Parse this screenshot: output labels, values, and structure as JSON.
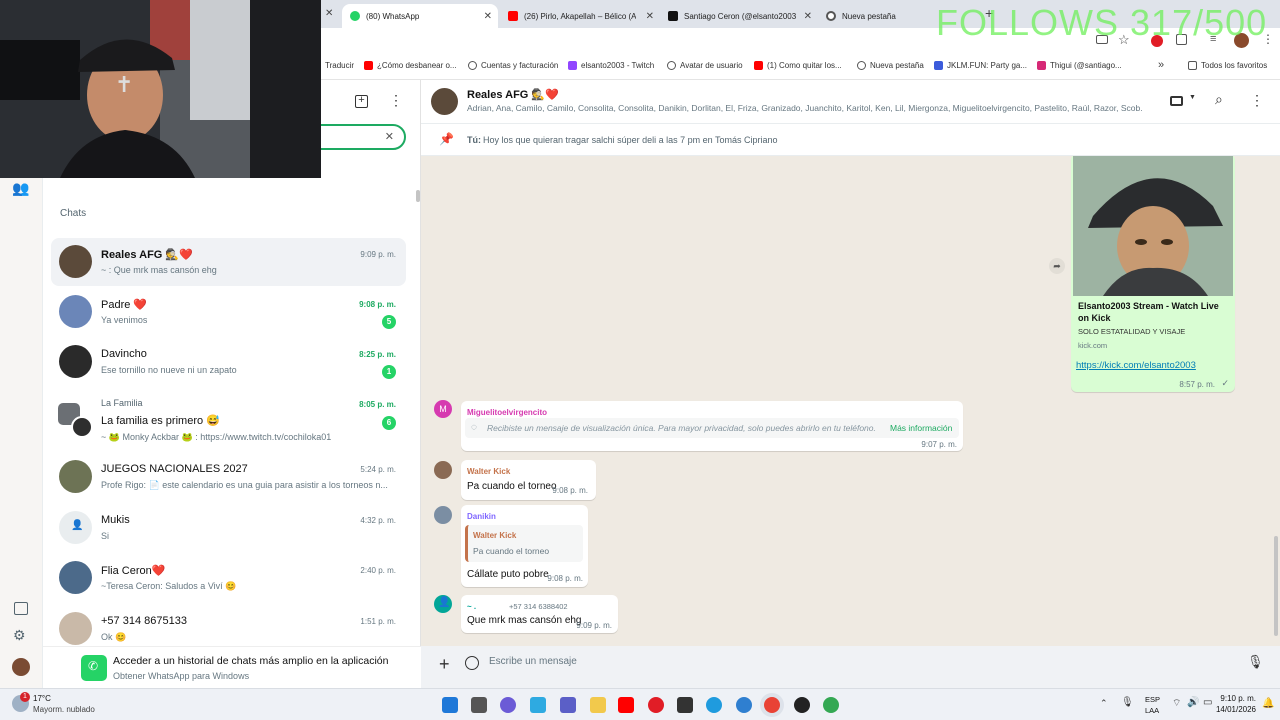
{
  "overlay": {
    "follows_text": "FOLLOWS 317/500"
  },
  "browser": {
    "tabs": [
      {
        "title": "(80) WhatsApp",
        "active": true,
        "icon": "whatsapp-icon"
      },
      {
        "title": "(26) Pirlo, Akapellah – Bélico (A",
        "active": false,
        "icon": "youtube-icon"
      },
      {
        "title": "Santiago Ceron (@elsanto2003",
        "active": false,
        "icon": "tiktok-icon"
      },
      {
        "title": "Nueva pestaña",
        "active": false,
        "icon": "chrome-icon"
      }
    ],
    "bookmarks": [
      {
        "label": "Traducir",
        "icon": ""
      },
      {
        "label": "¿Cómo desbanear o...",
        "icon": "youtube-icon"
      },
      {
        "label": "Cuentas y facturación",
        "icon": "globe-icon"
      },
      {
        "label": "elsanto2003 - Twitch",
        "icon": "twitch-icon"
      },
      {
        "label": "Avatar de usuario",
        "icon": "globe-icon"
      },
      {
        "label": "(1) Como quitar los...",
        "icon": "youtube-icon"
      },
      {
        "label": "Nueva pestaña",
        "icon": "chrome-icon"
      },
      {
        "label": "JKLM.FUN: Party ga...",
        "icon": "jklm-icon"
      },
      {
        "label": "Thigui (@santiago...",
        "icon": "instagram-icon"
      }
    ],
    "all_favorites": "Todos los favoritos"
  },
  "sidebar": {
    "section_title": "Chats",
    "chats": [
      {
        "name": "Reales AFG 🕵️❤️",
        "group": "",
        "preview": "~ : Que mrk mas cansón ehg",
        "time": "9:09 p. m.",
        "unread": "",
        "selected": true,
        "avatar_color": "#5b4a3a"
      },
      {
        "name": "Padre ❤️",
        "group": "",
        "preview": "Ya venimos",
        "time": "9:08 p. m.",
        "unread": "5",
        "selected": false,
        "avatar_color": "#6b86b8"
      },
      {
        "name": "Davincho",
        "group": "",
        "preview": "Ese tornillo no nueve ni un zapato",
        "time": "8:25 p. m.",
        "unread": "1",
        "selected": false,
        "avatar_color": "#2a2a2a"
      },
      {
        "name": "La familia es primero 😅",
        "group": "La Familia",
        "preview": "~ 🐸 Monky Ackbar 🐸 : https://www.twitch.tv/cochiloka01",
        "time": "8:05 p. m.",
        "unread": "6",
        "selected": false,
        "avatar_color": "#4a4a4a"
      },
      {
        "name": "JUEGOS NACIONALES 2027",
        "group": "",
        "preview": "Profe Rigo: 📄 este calendario es una guia para asistir a los torneos n...",
        "time": "5:24 p. m.",
        "unread": "",
        "selected": false,
        "avatar_color": "#6d7355"
      },
      {
        "name": "Mukis",
        "group": "",
        "preview": "Si",
        "time": "4:32 p. m.",
        "unread": "",
        "selected": false,
        "avatar_color": "#e9edef"
      },
      {
        "name": "Flia Ceron❤️",
        "group": "",
        "preview": "~Teresa Ceron: Saludos a Viví 😊",
        "time": "2:40 p. m.",
        "unread": "",
        "selected": false,
        "avatar_color": "#4c6a8a"
      },
      {
        "name": "+57 314 8675133",
        "group": "",
        "preview": "Ok 😊",
        "time": "1:51 p. m.",
        "unread": "",
        "selected": false,
        "avatar_color": "#c9b9a8"
      }
    ],
    "promo_title": "Acceder a un historial de chats más amplio en la aplicación",
    "promo_subtitle": "Obtener WhatsApp para Windows"
  },
  "conversation": {
    "title": "Reales AFG 🕵️❤️",
    "members": "Adrian, Ana, Camilo, Camilo, Consolita, Consolita, Danikin, Dorlitan, El, Friza, Granizado, Juanchito, Karitol, Ken, Lil, Miergonza, Miguelitoelvirgencito, Pastelito, Raúl, Razor, Scob...",
    "pinned_sender": "Tú:",
    "pinned_text": "Hoy los que quieran tragar salchi súper deli a las 7 pm en Tomás Cipriano",
    "link_card": {
      "title": "Elsanto2003 Stream - Watch Live on Kick",
      "description": "SOLO ESTATALIDAD Y VISAJE",
      "domain": "kick.com",
      "url": "https://kick.com/elsanto2003",
      "time": "8:57 p. m."
    },
    "view_once": {
      "sender": "Miguelitoelvirgencito",
      "avatar_letter": "M",
      "text": "Recibiste un mensaje de visualización única. Para mayor privacidad, solo puedes abrirlo en tu teléfono.",
      "link": "Más información",
      "time": "9:07 p. m."
    },
    "messages": [
      {
        "sender": "Walter Kick",
        "sender_color": "#c4734b",
        "text": "Pa cuando el torneo",
        "time": "9:08 p. m."
      },
      {
        "sender": "Danikin",
        "sender_color": "#7f66ff",
        "quote_sender": "Walter Kick",
        "quote_text": "Pa cuando el torneo",
        "text": "Cállate puto pobre",
        "time": "9:08 p. m."
      },
      {
        "sender": "~ .",
        "phone": "+57 314 6388402",
        "sender_color": "#02a698",
        "text": "Que mrk mas cansón ehg",
        "time": "9:09 p. m."
      }
    ],
    "composer_placeholder": "Escribe un mensaje"
  },
  "taskbar": {
    "weather_temp": "17°C",
    "weather_desc": "Mayorm. nublado",
    "weather_badge": "1",
    "lang_top": "ESP",
    "lang_bottom": "LAA",
    "time": "9:10 p. m.",
    "date": "14/01/2026"
  },
  "colors": {
    "whatsapp_green": "#25d366",
    "accent_teal": "#008069",
    "unread_green": "#1daa61"
  }
}
